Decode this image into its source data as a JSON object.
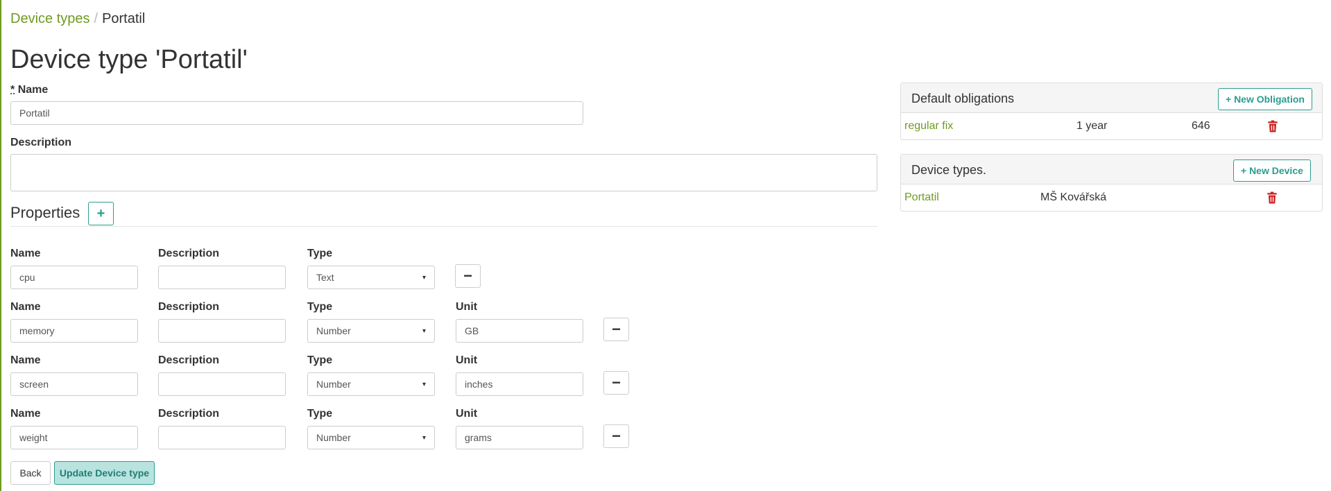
{
  "breadcrumb": {
    "parent": "Device types",
    "separator": "/",
    "current": "Portatil"
  },
  "page_title": "Device type 'Portatil'",
  "form": {
    "required_marker": "*",
    "name_label": "Name",
    "name_value": "Portatil",
    "description_label": "Description",
    "description_value": ""
  },
  "properties": {
    "title": "Properties",
    "add_icon": "plus-icon",
    "add_symbol": "+",
    "remove_symbol": "−",
    "col_name": "Name",
    "col_description": "Description",
    "col_type": "Type",
    "col_unit": "Unit",
    "caret": "▾",
    "rows": [
      {
        "name": "cpu",
        "description": "",
        "type": "Text",
        "unit": null
      },
      {
        "name": "memory",
        "description": "",
        "type": "Number",
        "unit": "GB"
      },
      {
        "name": "screen",
        "description": "",
        "type": "Number",
        "unit": "inches"
      },
      {
        "name": "weight",
        "description": "",
        "type": "Number",
        "unit": "grams"
      }
    ]
  },
  "actions": {
    "back_label": "Back",
    "update_label": "Update Device type"
  },
  "obligations_panel": {
    "title": "Default obligations",
    "new_label": "+ New Obligation",
    "rows": [
      {
        "name": "regular fix",
        "period": "1 year",
        "count": "646",
        "delete_icon": "trash-icon"
      }
    ]
  },
  "devices_panel": {
    "title": "Device types.",
    "new_label": "+ New Device",
    "rows": [
      {
        "name": "Portatil",
        "location": "MŠ Kovářská",
        "delete_icon": "trash-icon"
      }
    ]
  },
  "colors": {
    "link": "#6f9a1f",
    "accent": "#2a9d8f",
    "danger": "#cc2222"
  }
}
